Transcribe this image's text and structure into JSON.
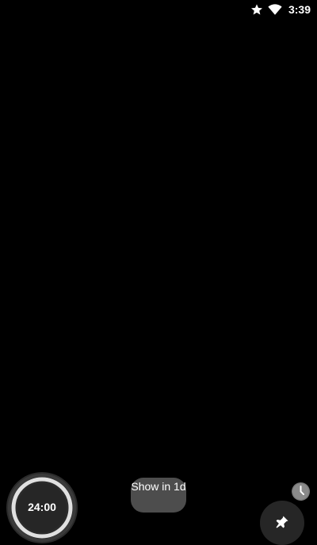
{
  "status_bar": {
    "time": "3:39",
    "icons": [
      "star-icon",
      "wifi-icon"
    ]
  },
  "timer": {
    "value": "24:00"
  },
  "show_in": {
    "label": "Show in 1d"
  },
  "clock_badge": {
    "icon": "clock-icon"
  },
  "fab": {
    "icon": "pin-icon"
  },
  "colors": {
    "background": "#000000",
    "pill": "#4d4d4d",
    "dial_ring": "#e0e0e0",
    "fab": "#262626"
  }
}
